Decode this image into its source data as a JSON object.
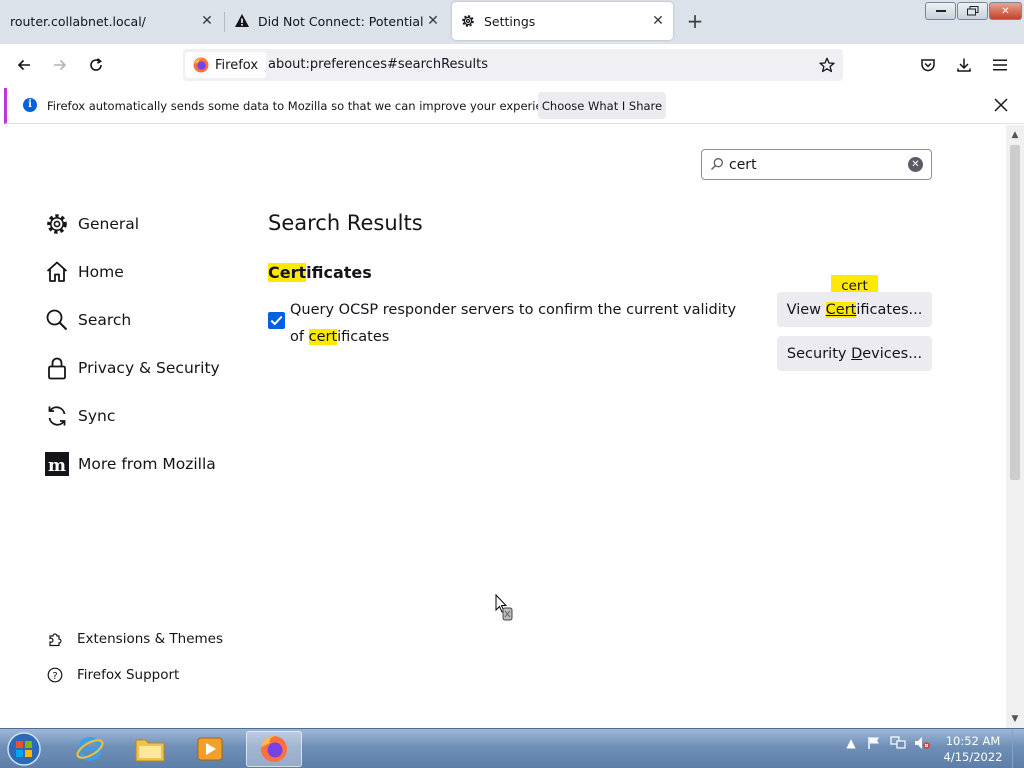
{
  "browser": {
    "tabs": [
      {
        "title": "router.collabnet.local/"
      },
      {
        "title": "Did Not Connect: Potential Security Issue"
      },
      {
        "title": "Settings"
      }
    ],
    "identity_label": "Firefox",
    "url": "about:preferences#searchResults"
  },
  "notification": {
    "message": "Firefox automatically sends some data to Mozilla so that we can improve your experience.",
    "button": "Choose What I Share"
  },
  "prefs": {
    "search_value": "cert",
    "categories": [
      {
        "label": "General",
        "icon": "gear-icon"
      },
      {
        "label": "Home",
        "icon": "home-icon"
      },
      {
        "label": "Search",
        "icon": "search-icon"
      },
      {
        "label": "Privacy & Security",
        "icon": "lock-icon"
      },
      {
        "label": "Sync",
        "icon": "sync-icon"
      },
      {
        "label": "More from Mozilla",
        "icon": "mozilla-icon"
      }
    ],
    "footer_links": [
      {
        "label": "Extensions & Themes",
        "icon": "puzzle-icon"
      },
      {
        "label": "Firefox Support",
        "icon": "help-icon"
      }
    ],
    "results_title": "Search Results",
    "section": {
      "title_highlight": "Cert",
      "title_rest": "ificates"
    },
    "ocsp": {
      "checked": true,
      "text_before": "Query OCSP responder servers to confirm the current validity of ",
      "highlight": "cert",
      "text_after": "ificates"
    },
    "view_btn": {
      "before": "View ",
      "highlight": "Cert",
      "after": "ificates..."
    },
    "devices_btn": {
      "before": "Security ",
      "underline": "D",
      "after": "evices..."
    },
    "tooltip": "cert"
  },
  "taskbar": {
    "time": "10:52 AM",
    "date": "4/15/2022"
  },
  "colors": {
    "accent": "#0061e0",
    "highlight": "#ffe900",
    "notice_bar": "#c235d9"
  }
}
